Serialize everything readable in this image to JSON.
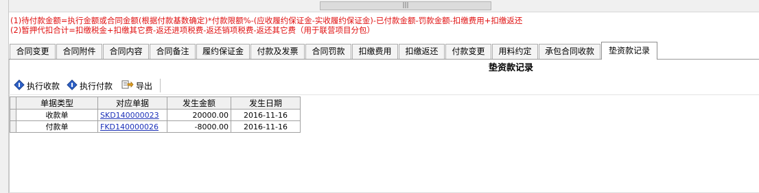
{
  "scroll": {
    "thumb_label": "|||"
  },
  "notes": [
    "(1)待付款金额=执行金额或合同金额(根据付款基数确定)*付款限额%-(应收履约保证金-实收履约保证金)-已付款金额-罚款金额-扣缴费用+扣缴返还",
    "(2)暂押代扣合计=扣缴税金+扣缴其它费-返还进项税费-返还销项税费-返还其它费（用于联营项目分包）"
  ],
  "tabs": [
    {
      "label": "合同变更"
    },
    {
      "label": "合同附件"
    },
    {
      "label": "合同内容"
    },
    {
      "label": "合同备注"
    },
    {
      "label": "履约保证金"
    },
    {
      "label": "付款及发票"
    },
    {
      "label": "合同罚款"
    },
    {
      "label": "扣缴费用"
    },
    {
      "label": "扣缴返还"
    },
    {
      "label": "付款变更"
    },
    {
      "label": "用料约定"
    },
    {
      "label": "承包合同收款"
    },
    {
      "label": "垫资款记录",
      "active": true
    }
  ],
  "panel": {
    "title": "垫资款记录"
  },
  "toolbar": {
    "exec_receive": "执行收款",
    "exec_pay": "执行付款",
    "export": "导出"
  },
  "table": {
    "columns": [
      "单据类型",
      "对应单据",
      "发生金额",
      "发生日期"
    ],
    "rows": [
      {
        "type": "收款单",
        "doc": "SKD140000023",
        "amount": "20000.00",
        "date": "2016-11-16"
      },
      {
        "type": "付款单",
        "doc": "FKD140000026",
        "amount": "-8000.00",
        "date": "2016-11-16"
      }
    ]
  },
  "colors": {
    "note_red": "#e01010",
    "link_blue": "#1a2fb8"
  }
}
